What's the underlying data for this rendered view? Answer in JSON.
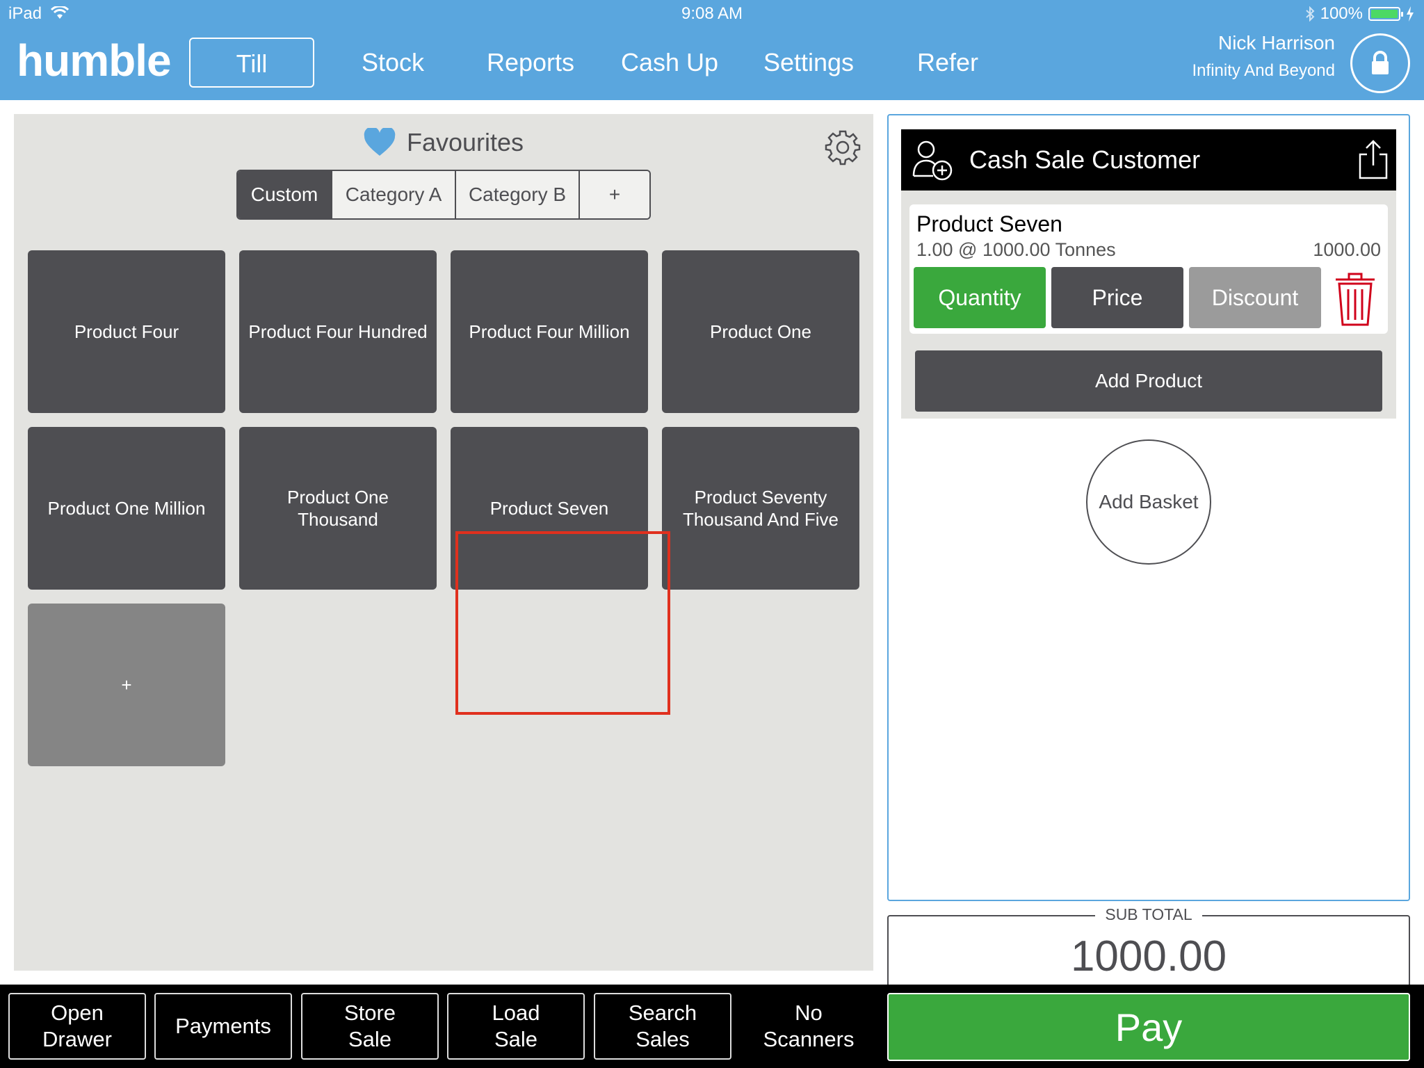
{
  "status_bar": {
    "device": "iPad",
    "time": "9:08 AM",
    "battery": "100%"
  },
  "header": {
    "logo": "humble",
    "nav": [
      "Till",
      "Stock",
      "Reports",
      "Cash Up",
      "Settings",
      "Refer"
    ],
    "active_nav": "Till",
    "user_name": "Nick Harrison",
    "organisation": "Infinity And Beyond"
  },
  "favourites": {
    "title": "Favourites",
    "tabs": [
      "Custom",
      "Category A",
      "Category B",
      "+"
    ],
    "active_tab": "Custom",
    "products": [
      "Product Four",
      "Product Four Hundred",
      "Product Four Million",
      "Product One",
      "Product One Million",
      "Product One Thousand",
      "Product Seven",
      "Product Seventy Thousand And Five"
    ],
    "add_tile": "+"
  },
  "cart": {
    "customer": "Cash Sale Customer",
    "line_item": {
      "name": "Product Seven",
      "detail": "1.00 @ 1000.00 Tonnes",
      "total": "1000.00",
      "buttons": {
        "quantity": "Quantity",
        "price": "Price",
        "discount": "Discount"
      }
    },
    "add_product": "Add Product",
    "add_basket": "Add Basket",
    "subtotal_label": "SUB TOTAL",
    "subtotal_value": "1000.00"
  },
  "bottom_bar": {
    "open_drawer": "Open\nDrawer",
    "payments": "Payments",
    "store_sale": "Store\nSale",
    "load_sale": "Load\nSale",
    "search_sales": "Search\nSales",
    "no_scanners": "No\nScanners",
    "pay": "Pay"
  },
  "colors": {
    "header_blue": "#5aa6de",
    "tile_dark": "#4e4e52",
    "quantity_green": "#3aa83d",
    "discount_grey": "#9b9b9b",
    "highlight_red": "#e0301e",
    "trash_red": "#d0021b",
    "heart_blue": "#5aa6de"
  }
}
